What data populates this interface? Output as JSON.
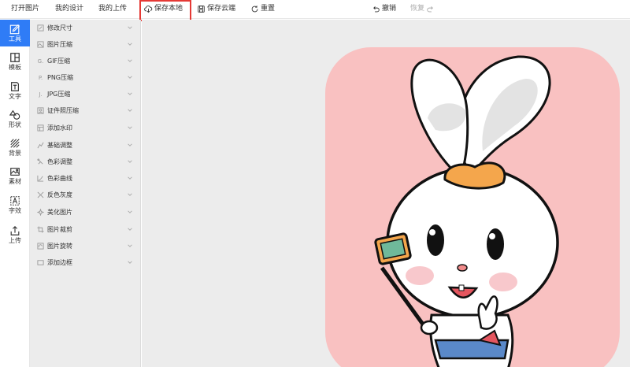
{
  "toolbar": {
    "open_image": "打开图片",
    "my_designs": "我的设计",
    "my_uploads": "我的上传",
    "save_local": "保存本地",
    "save_cloud": "保存云端",
    "reset": "重置",
    "undo": "撤销",
    "redo": "恢复"
  },
  "sidebar": {
    "items": [
      {
        "label": "工具",
        "icon": "edit-icon",
        "active": true
      },
      {
        "label": "模板",
        "icon": "template-icon"
      },
      {
        "label": "文字",
        "icon": "text-icon"
      },
      {
        "label": "形状",
        "icon": "shapes-icon"
      },
      {
        "label": "背景",
        "icon": "background-icon"
      },
      {
        "label": "素材",
        "icon": "image-icon"
      },
      {
        "label": "字效",
        "icon": "text-effect-icon"
      },
      {
        "label": "上传",
        "icon": "upload-icon"
      }
    ]
  },
  "tools": {
    "items": [
      {
        "label": "修改尺寸",
        "icon": "resize-icon"
      },
      {
        "label": "图片压缩",
        "icon": "compress-icon"
      },
      {
        "label": "GIF压缩",
        "icon": "gif-icon"
      },
      {
        "label": "PNG压缩",
        "icon": "png-icon"
      },
      {
        "label": "JPG压缩",
        "icon": "jpg-icon"
      },
      {
        "label": "证件照压缩",
        "icon": "id-photo-icon"
      },
      {
        "label": "添加水印",
        "icon": "watermark-icon"
      },
      {
        "label": "基础调整",
        "icon": "adjust-icon"
      },
      {
        "label": "色彩调整",
        "icon": "color-icon"
      },
      {
        "label": "色彩曲线",
        "icon": "curve-icon"
      },
      {
        "label": "反色灰度",
        "icon": "invert-icon"
      },
      {
        "label": "美化图片",
        "icon": "beautify-icon"
      },
      {
        "label": "图片裁剪",
        "icon": "crop-icon"
      },
      {
        "label": "图片旋转",
        "icon": "rotate-icon"
      },
      {
        "label": "添加边框",
        "icon": "border-icon"
      }
    ]
  },
  "colors": {
    "accent": "#2f7cf6",
    "highlight": "#e53935",
    "art_background": "#f9c1c1"
  }
}
